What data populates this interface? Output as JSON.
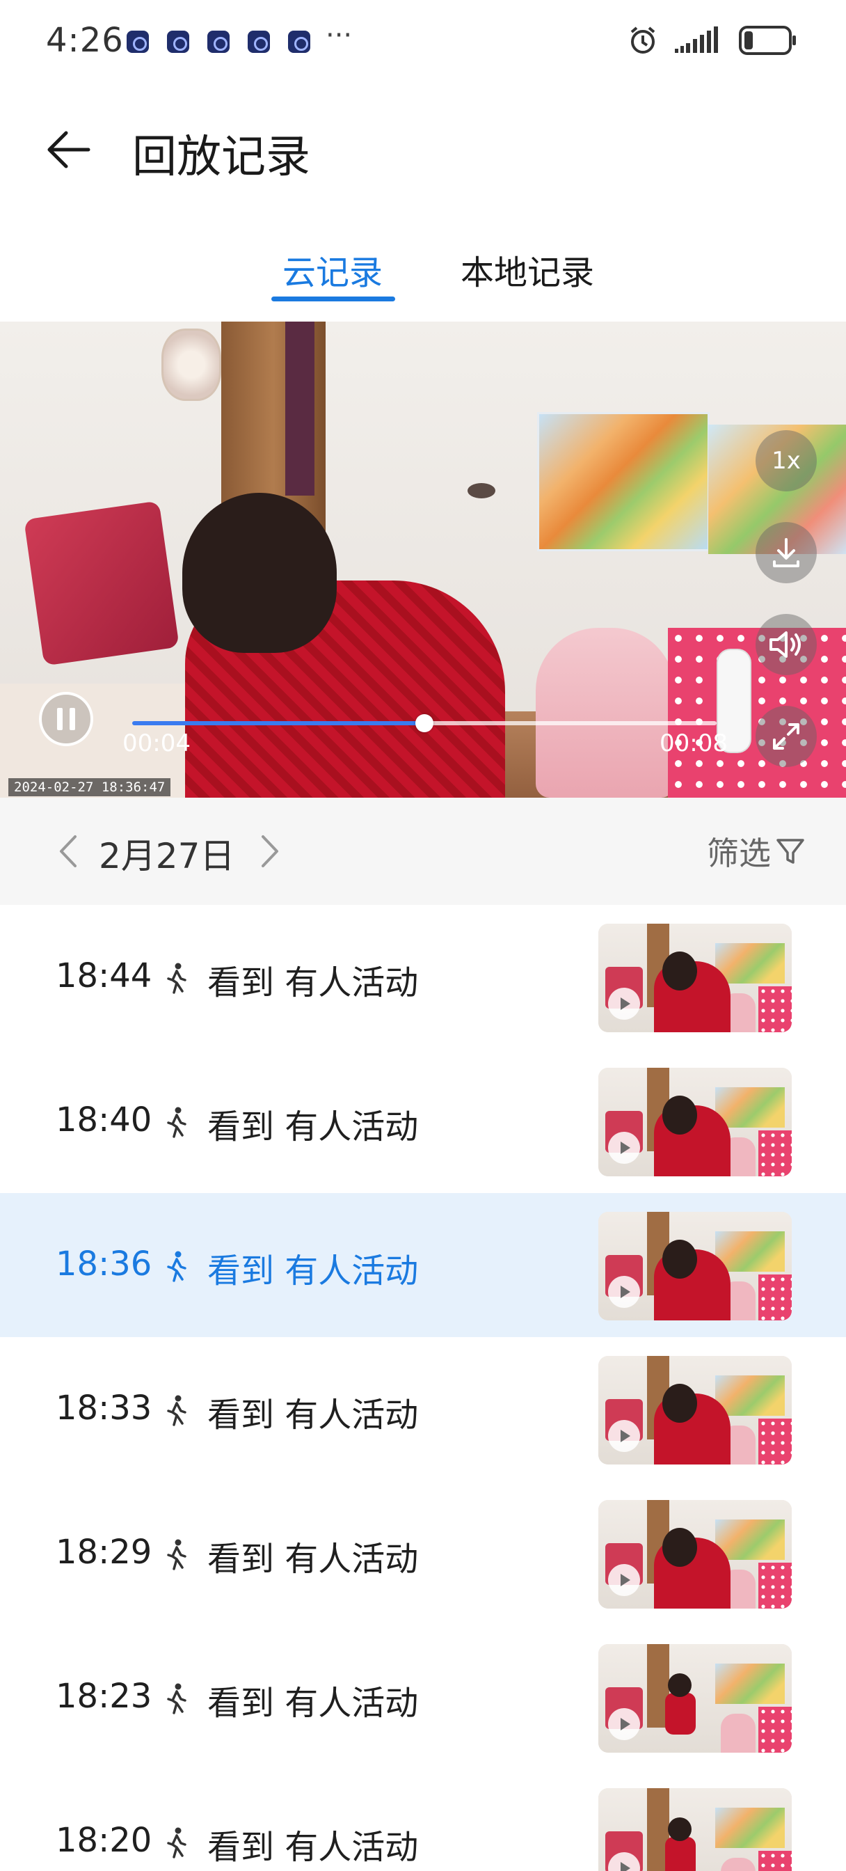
{
  "status_bar": {
    "time": "4:26",
    "more": "···",
    "notification_icons": [
      "app-icon-1",
      "app-icon-2",
      "app-icon-3",
      "app-icon-4",
      "app-icon-5"
    ],
    "right_icons": [
      "alarm-icon",
      "signal-icon",
      "battery-icon"
    ],
    "battery_level": 0.2
  },
  "header": {
    "title": "回放记录"
  },
  "tabs": [
    {
      "label": "云记录",
      "active": true
    },
    {
      "label": "本地记录",
      "active": false
    }
  ],
  "player": {
    "timestamp": "2024-02-27  18:36:47",
    "speed": "1x",
    "current_time": "00:04",
    "total_time": "00:08",
    "progress": 0.5,
    "accent_color": "#3a7bf0"
  },
  "date_bar": {
    "date": "2月27日",
    "filter_label": "筛选"
  },
  "records": [
    {
      "time": "18:44",
      "event": "看到 有人活动",
      "selected": false
    },
    {
      "time": "18:40",
      "event": "看到 有人活动",
      "selected": false
    },
    {
      "time": "18:36",
      "event": "看到 有人活动",
      "selected": true
    },
    {
      "time": "18:33",
      "event": "看到 有人活动",
      "selected": false
    },
    {
      "time": "18:29",
      "event": "看到 有人活动",
      "selected": false
    },
    {
      "time": "18:23",
      "event": "看到 有人活动",
      "selected": false
    },
    {
      "time": "18:20",
      "event": "看到 有人活动",
      "selected": false
    }
  ],
  "colors": {
    "accent": "#1a7ae0",
    "selected_row": "#e6f1fc"
  }
}
